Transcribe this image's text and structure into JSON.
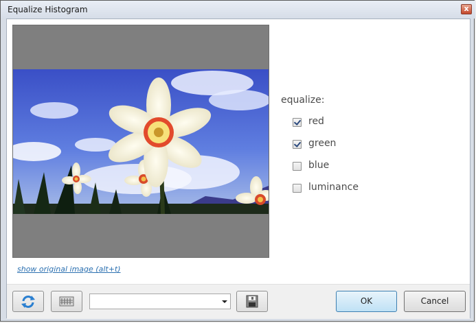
{
  "window": {
    "title": "Equalize Histogram",
    "close_glyph": "x"
  },
  "preview": {
    "show_original_label": "show original image (alt+t)"
  },
  "options": {
    "label": "equalize:",
    "items": [
      {
        "label": "red",
        "checked": true
      },
      {
        "label": "green",
        "checked": true
      },
      {
        "label": "blue",
        "checked": false
      },
      {
        "label": "luminance",
        "checked": false
      }
    ]
  },
  "footer": {
    "refresh_icon": "refresh-icon",
    "adjust_icon": "sliders-icon",
    "preset_value": "",
    "save_icon": "save-preset-icon",
    "ok_label": "OK",
    "cancel_label": "Cancel"
  },
  "colors": {
    "link": "#2a6fb0",
    "ok_border": "#3c7fb1",
    "frame_gray": "#7f7f7f"
  }
}
